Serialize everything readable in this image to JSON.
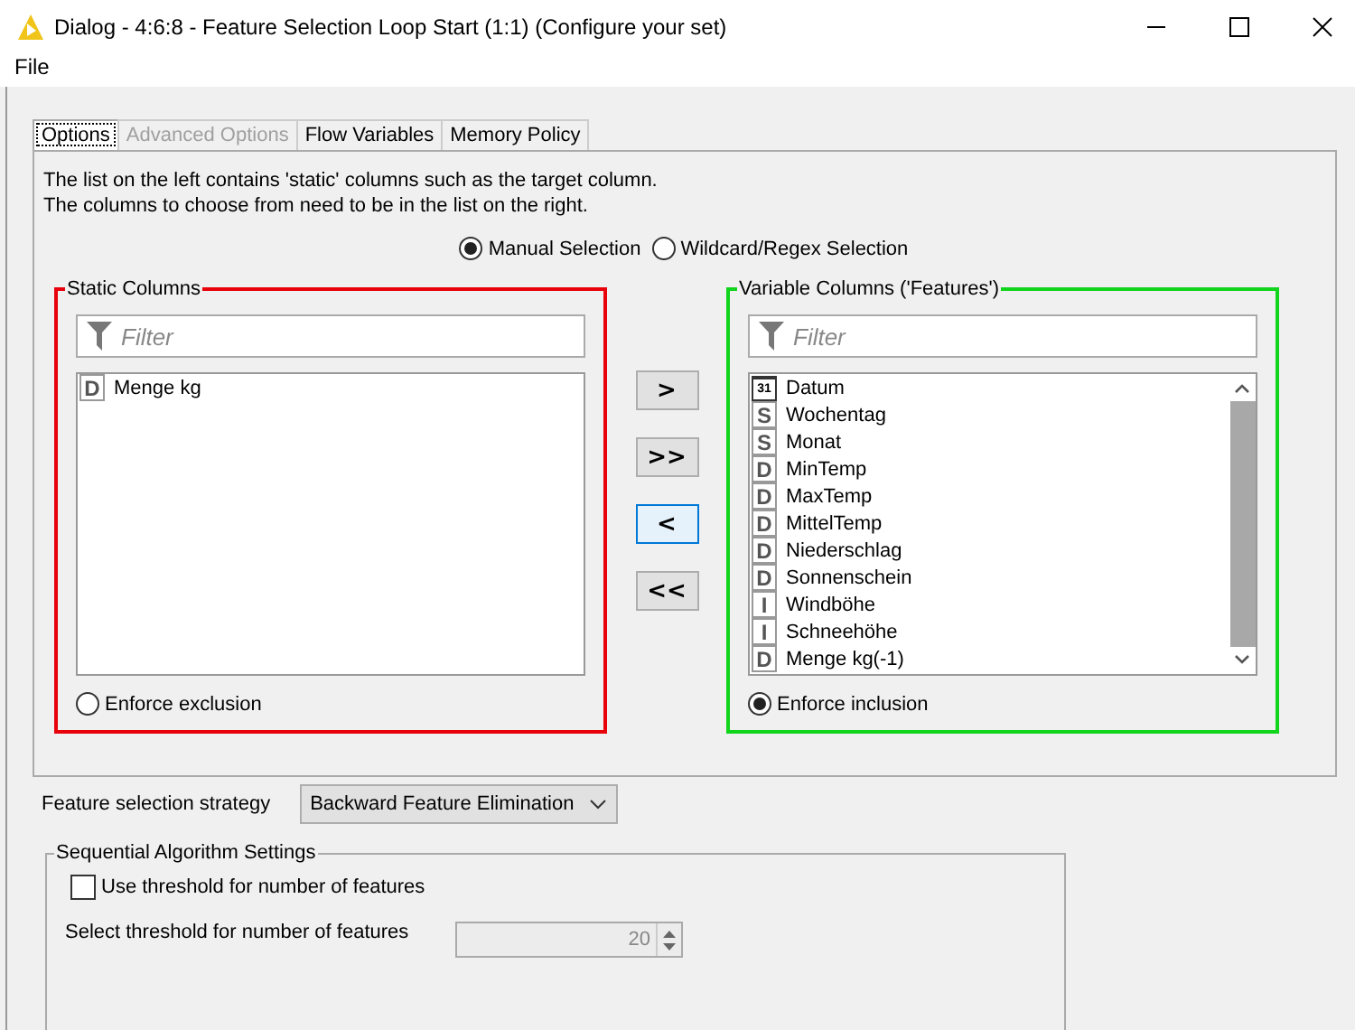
{
  "window": {
    "title": "Dialog - 4:6:8 - Feature Selection Loop Start (1:1) (Configure your set)"
  },
  "menu": [
    "File"
  ],
  "tabs": [
    {
      "label": "Options",
      "selected": true,
      "disabled": false
    },
    {
      "label": "Advanced Options",
      "selected": false,
      "disabled": true
    },
    {
      "label": "Flow Variables",
      "selected": false,
      "disabled": false
    },
    {
      "label": "Memory Policy",
      "selected": false,
      "disabled": false
    }
  ],
  "description": [
    "The list on the left contains 'static' columns such as the target column.",
    "The columns to choose from need to be in the list on the right."
  ],
  "selection_mode": [
    {
      "label": "Manual Selection",
      "selected": true
    },
    {
      "label": "Wildcard/Regex Selection",
      "selected": false
    }
  ],
  "static_columns": {
    "title": "Static Columns",
    "color": "#e8000b",
    "filter": {
      "placeholder": "Filter"
    },
    "items": [
      {
        "kind": "letter",
        "badge": "D",
        "name": "Menge kg"
      }
    ],
    "enforce": {
      "label": "Enforce exclusion",
      "selected": false
    }
  },
  "move_buttons": [
    {
      "label": ">",
      "focused": false
    },
    {
      "label": ">>",
      "focused": false
    },
    {
      "label": "<",
      "focused": true
    },
    {
      "label": "<<",
      "focused": false
    }
  ],
  "variable_columns": {
    "title": "Variable Columns ('Features')",
    "color": "#11d41c",
    "filter": {
      "placeholder": "Filter"
    },
    "items": [
      {
        "kind": "date",
        "badge": "31",
        "name": "Datum"
      },
      {
        "kind": "letter",
        "badge": "S",
        "name": "Wochentag"
      },
      {
        "kind": "letter",
        "badge": "S",
        "name": "Monat"
      },
      {
        "kind": "letter",
        "badge": "D",
        "name": "MinTemp"
      },
      {
        "kind": "letter",
        "badge": "D",
        "name": "MaxTemp"
      },
      {
        "kind": "letter",
        "badge": "D",
        "name": "MittelTemp"
      },
      {
        "kind": "letter",
        "badge": "D",
        "name": "Niederschlag"
      },
      {
        "kind": "letter",
        "badge": "D",
        "name": "Sonnenschein"
      },
      {
        "kind": "letter",
        "badge": "I",
        "name": "Windböhe"
      },
      {
        "kind": "letter",
        "badge": "I",
        "name": "Schneehöhe"
      },
      {
        "kind": "letter",
        "badge": "D",
        "name": "Menge kg(-1)"
      }
    ],
    "enforce": {
      "label": "Enforce inclusion",
      "selected": true
    }
  },
  "strategy": {
    "label": "Feature selection strategy",
    "value": "Backward Feature Elimination"
  },
  "sequential": {
    "title": "Sequential Algorithm Settings",
    "use_threshold": {
      "label": "Use threshold for number of features",
      "checked": false
    },
    "threshold": {
      "label": "Select threshold for number of features",
      "value": "20",
      "disabled": true
    }
  }
}
